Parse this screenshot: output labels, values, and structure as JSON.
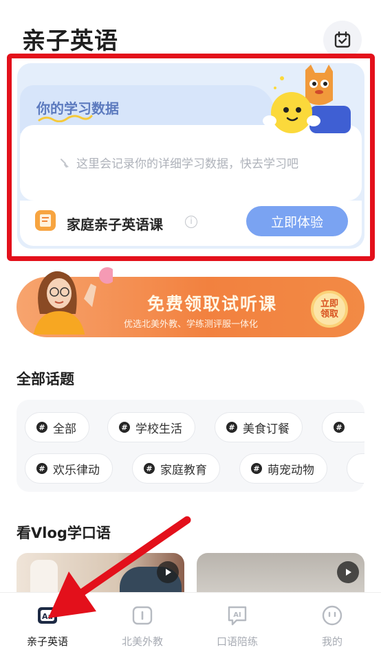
{
  "page": {
    "title": "亲子英语"
  },
  "study_card": {
    "label": "你的学习数据",
    "empty_text": "这里会记录你的详细学习数据，快去学习吧",
    "course_name": "家庭亲子英语课",
    "info_icon": "i",
    "try_button": "立即体验"
  },
  "banner": {
    "title": "免费领取试听课",
    "subtitle": "优选北美外教、学练测评服一体化",
    "button_line1": "立即",
    "button_line2": "领取"
  },
  "topics": {
    "title": "全部话题",
    "row1": [
      "全部",
      "学校生活",
      "美食订餐"
    ],
    "row2": [
      "欢乐律动",
      "家庭教育",
      "萌宠动物"
    ]
  },
  "vlog": {
    "title": "看Vlog学口语"
  },
  "tabbar": {
    "items": [
      {
        "label": "亲子英语",
        "icon": "aa-book-icon",
        "active": true
      },
      {
        "label": "北美外教",
        "icon": "teacher-icon",
        "active": false
      },
      {
        "label": "口语陪练",
        "icon": "ai-chat-icon",
        "active": false
      },
      {
        "label": "我的",
        "icon": "profile-icon",
        "active": false
      }
    ]
  },
  "colors": {
    "highlight": "#e3101b",
    "primary_button": "#7aa3f2",
    "banner_orange": "#f2813f",
    "arrow": "#e3101b"
  }
}
